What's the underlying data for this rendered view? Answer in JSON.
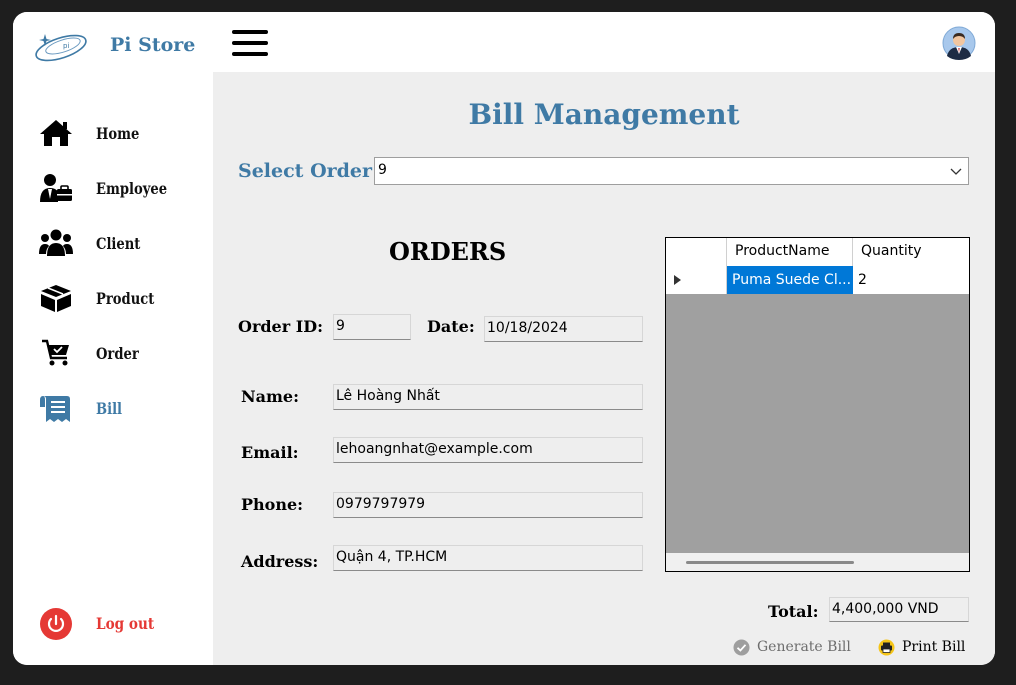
{
  "app": {
    "brand": "Pi Store"
  },
  "sidebar": {
    "items": [
      {
        "label": "Home",
        "icon": "home-icon"
      },
      {
        "label": "Employee",
        "icon": "employee-icon"
      },
      {
        "label": "Client",
        "icon": "clients-icon"
      },
      {
        "label": "Product",
        "icon": "product-box-icon"
      },
      {
        "label": "Order",
        "icon": "cart-icon"
      },
      {
        "label": "Bill",
        "icon": "bill-icon",
        "active": true
      }
    ],
    "logout_label": "Log out"
  },
  "main": {
    "title": "Bill Management",
    "select_label": "Select Order",
    "selected_order": "9",
    "orders_title": "ORDERS",
    "fields": {
      "order_id_label": "Order ID:",
      "order_id": "9",
      "date_label": "Date:",
      "date": "10/18/2024",
      "name_label": "Name:",
      "name": "Lê Hoàng Nhất",
      "email_label": "Email:",
      "email": "lehoangnhat@example.com",
      "phone_label": "Phone:",
      "phone": "0979797979",
      "address_label": "Address:",
      "address": "Quận 4, TP.HCM"
    },
    "grid": {
      "columns": [
        "ProductName",
        "Quantity"
      ],
      "rows": [
        {
          "ProductName": "Puma Suede Cl...",
          "Quantity": "2"
        }
      ]
    },
    "total_label": "Total:",
    "total": "4,400,000 VND",
    "generate_label": "Generate Bill",
    "print_label": "Print Bill"
  },
  "colors": {
    "accent": "#3f7aa5",
    "logout": "#e53935",
    "selection": "#0078d7"
  }
}
